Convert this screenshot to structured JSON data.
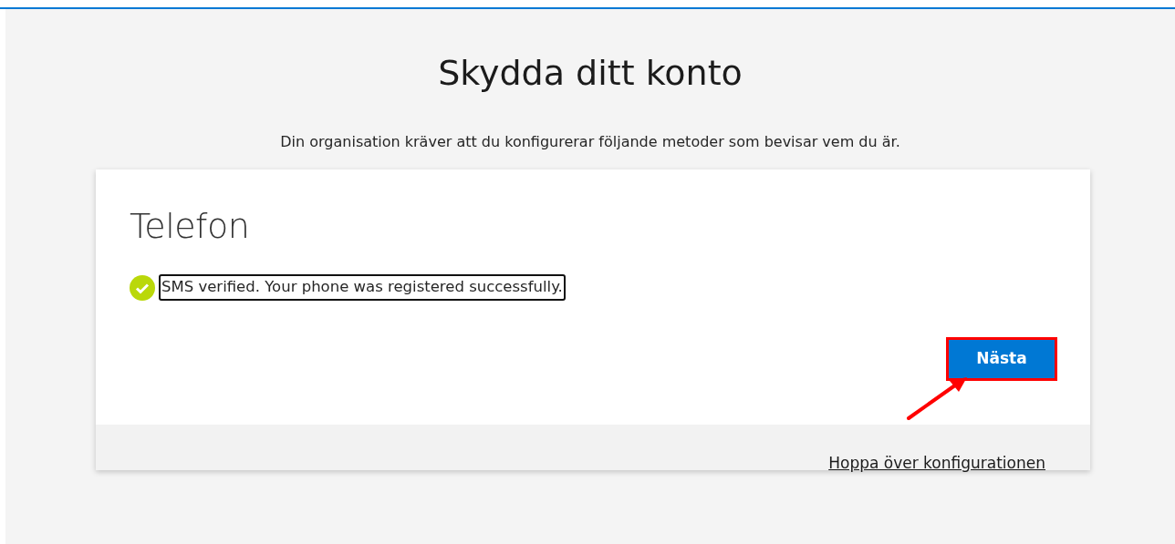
{
  "title": "Skydda ditt konto",
  "subtitle": "Din organisation kräver att du konfigurerar följande metoder som bevisar vem du är.",
  "card": {
    "heading": "Telefon",
    "status": {
      "text": "SMS verified. Your phone was registered successfully.",
      "verified": true,
      "focused": true
    },
    "next_button": {
      "label": "Nästa",
      "highlighted": true
    },
    "skip_link": "Hoppa över konfigurationen"
  }
}
